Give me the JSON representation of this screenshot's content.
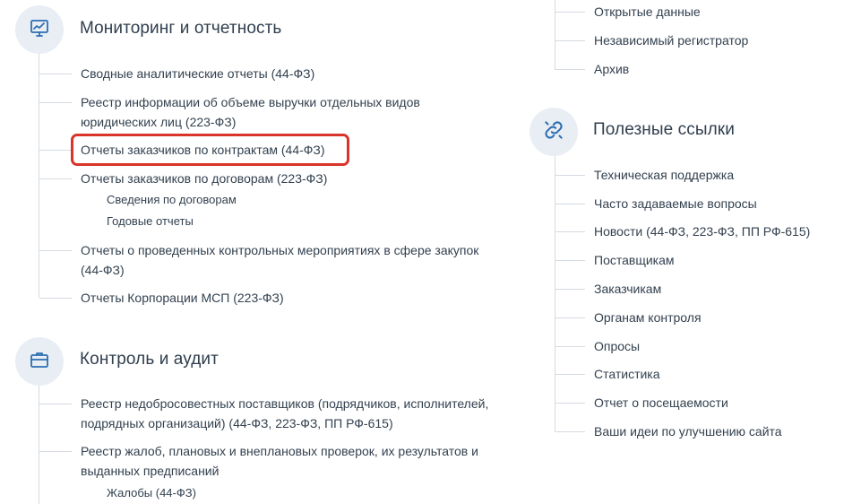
{
  "monitoring": {
    "title": "Мониторинг и отчетность",
    "links": [
      "Сводные аналитические отчеты (44-ФЗ)",
      "Реестр информации об объеме выручки отдельных видов юридических лиц (223-ФЗ)",
      "Отчеты заказчиков по контрактам (44-ФЗ)",
      "Отчеты заказчиков по договорам (223-ФЗ)",
      "Отчеты о проведенных контрольных мероприятиях в сфере закупок (44-ФЗ)",
      "Отчеты Корпорации МСП (223-ФЗ)"
    ],
    "sublinks": [
      "Сведения по договорам",
      "Годовые отчеты"
    ]
  },
  "audit": {
    "title": "Контроль и аудит",
    "links": [
      "Реестр недобросовестных поставщиков (подрядчиков, исполнителей, подрядных организаций) (44-ФЗ, 223-ФЗ, ПП РФ-615)",
      "Реестр жалоб, плановых и внеплановых проверок, их результатов и выданных предписаний"
    ],
    "sublinks": [
      "Жалобы (44-ФЗ)"
    ]
  },
  "top_right": {
    "links": [
      "Открытые данные",
      "Независимый регистратор",
      "Архив"
    ]
  },
  "useful": {
    "title": "Полезные ссылки",
    "links": [
      "Техническая поддержка",
      "Часто задаваемые вопросы",
      "Новости (44-ФЗ, 223-ФЗ, ПП РФ-615)",
      "Поставщикам",
      "Заказчикам",
      "Органам контроля",
      "Опросы",
      "Статистика",
      "Отчет о посещаемости",
      "Ваши идеи по улучшению сайта"
    ]
  },
  "colors": {
    "accent": "#2d6fb1",
    "highlight": "#d8342a",
    "circle_bg": "#e9eef4"
  },
  "icons": {
    "monitoring": "monitor-chart-icon",
    "audit": "briefcase-icon",
    "useful": "chain-link-icon"
  }
}
